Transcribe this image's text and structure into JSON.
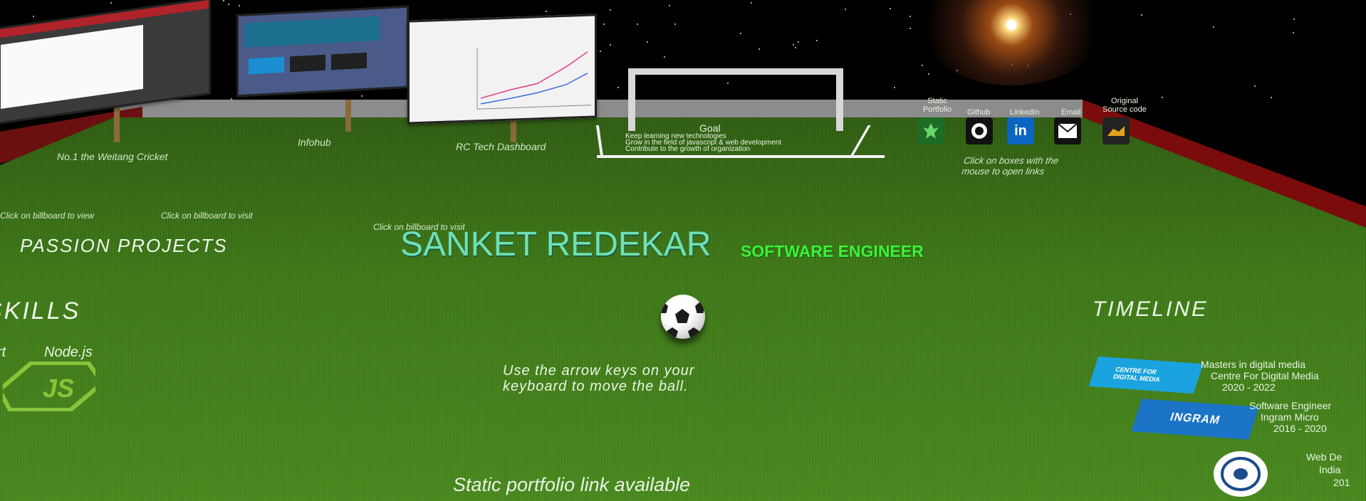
{
  "main": {
    "name": "SANKET REDEKAR",
    "role": "SOFTWARE ENGINEER",
    "instruction_line1": "Use the arrow keys on your",
    "instruction_line2": "keyboard to move the ball.",
    "static_note": "Static portfolio link available"
  },
  "goal": {
    "title": "Goal",
    "line1": "Keep learning new technologies",
    "line2": "Grow in the field of javascript & web development",
    "line3": "Contribute to the growth of organization"
  },
  "social": {
    "items": [
      {
        "label": "Static Portfolio",
        "icon": "static-portfolio-icon",
        "color": "#1d6b24"
      },
      {
        "label": "Github",
        "icon": "github-icon",
        "color": "#111111"
      },
      {
        "label": "LinkedIn",
        "icon": "linkedin-icon",
        "color": "#0a66c2"
      },
      {
        "label": "Email",
        "icon": "email-icon",
        "color": "#111111"
      },
      {
        "label": "Original Source code",
        "icon": "source-code-icon",
        "color": "#222222"
      }
    ],
    "hint": "Click on boxes with the mouse to open links"
  },
  "projects": {
    "heading": "PASSION PROJECTS",
    "p1_title": "No.1 the Weitang Cricket",
    "p1_hint": "Click on billboard to view",
    "p2_title": "Infohub",
    "p2_hint": "Click on billboard to visit",
    "p3_title": "RC Tech Dashboard",
    "p3_hint": "Click on billboard to visit"
  },
  "skills": {
    "heading": "SKILLS",
    "node": "Node.js",
    "other": "rt"
  },
  "timeline": {
    "heading": "TIMELINE",
    "e1_logo": "CENTRE FOR DIGITAL MEDIA",
    "e1_line1": "Masters in digital media",
    "e1_line2": "Centre For Digital Media",
    "e1_line3": "2020 - 2022",
    "e2_logo": "INGRAM",
    "e2_line1": "Software Engineer",
    "e2_line2": "Ingram Micro",
    "e2_line3": "2016 - 2020",
    "e3_line1": "Web De",
    "e3_line2": "India",
    "e3_line3": "201"
  },
  "colors": {
    "name": "#6fe0b7",
    "role": "#3ff03a",
    "grass": "#3f7a18",
    "wall": "#7a0c0c"
  }
}
